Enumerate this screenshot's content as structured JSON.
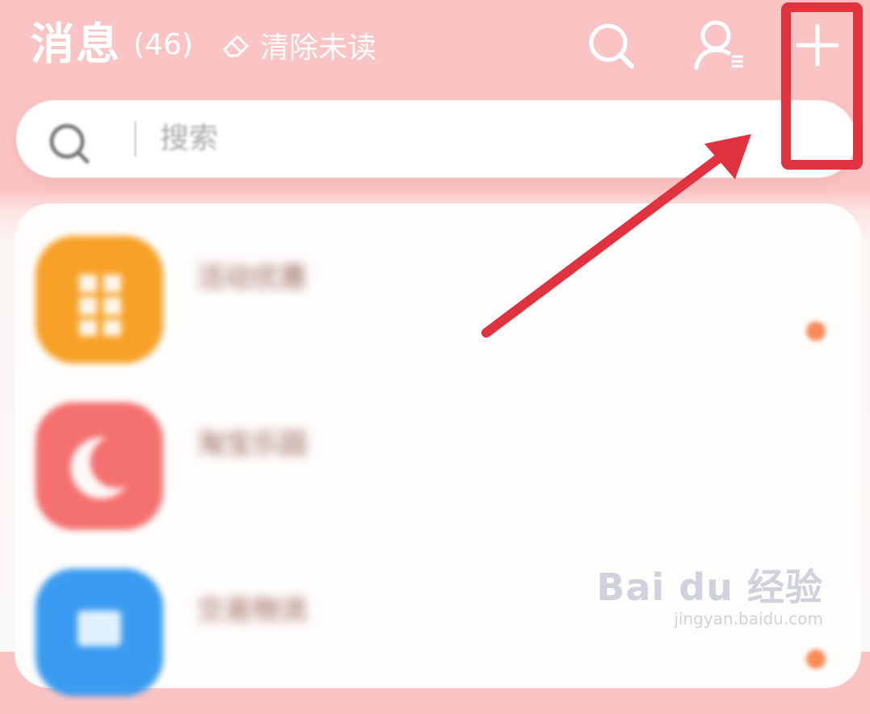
{
  "header": {
    "title": "消息",
    "unread_count": "(46)",
    "clear_unread_label": "清除未读",
    "icons": [
      "search-icon",
      "contacts-icon",
      "add-icon"
    ]
  },
  "search": {
    "placeholder": "搜索",
    "icon": "search-icon"
  },
  "conversations": [
    {
      "name": "活动优惠",
      "preview": "",
      "time": "",
      "avatar_color": "#f7a128",
      "avatar_icon": "gift-icon",
      "unread_dot": true
    },
    {
      "name": "淘宝乐园",
      "preview": "",
      "time": "",
      "avatar_color": "#f4716f",
      "avatar_icon": "moon-icon",
      "unread_dot": false
    },
    {
      "name": "交易物流",
      "preview": "",
      "time": "",
      "avatar_color": "#3a9bf0",
      "avatar_icon": "box-icon",
      "unread_dot": true
    }
  ],
  "colors": {
    "header_bg": "#fbc4c4",
    "highlight_red": "#e0323f",
    "unread_dot": "#f78b58"
  },
  "watermark": {
    "brand": "Bai du 经验",
    "url": "jingyan.baidu.com"
  }
}
